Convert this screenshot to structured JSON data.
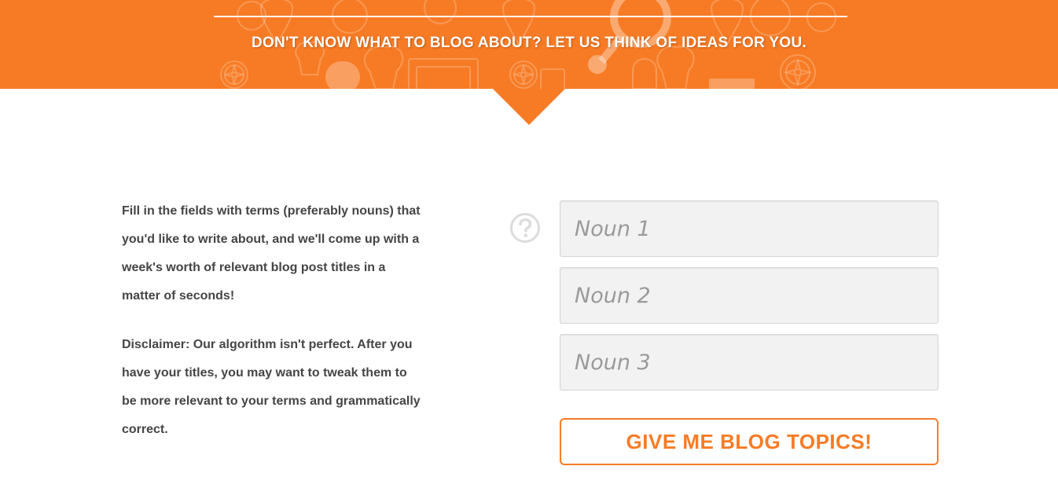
{
  "banner": {
    "title": "DON'T KNOW WHAT TO BLOG ABOUT? LET US THINK OF IDEAS FOR YOU.",
    "background_color": "#f77b25",
    "decoration_icons": [
      "compass-icon",
      "lightbulb-icon",
      "magnifier-icon",
      "frame-icon",
      "map-pin-icon"
    ]
  },
  "intro": {
    "paragraph_1": "Fill in the fields with terms (preferably nouns) that you'd like to write about, and we'll come up with a week's worth of relevant blog post titles in a matter of seconds!",
    "paragraph_2": "Disclaimer: Our algorithm isn't perfect. After you have your titles, you may want to tweak them to be more relevant to your terms and grammatically correct."
  },
  "form": {
    "help_icon": "question-circle-icon",
    "fields": [
      {
        "placeholder": "Noun 1",
        "value": ""
      },
      {
        "placeholder": "Noun 2",
        "value": ""
      },
      {
        "placeholder": "Noun 3",
        "value": ""
      }
    ],
    "submit_label": "GIVE ME BLOG TOPICS!",
    "accent_color": "#f77b25"
  }
}
